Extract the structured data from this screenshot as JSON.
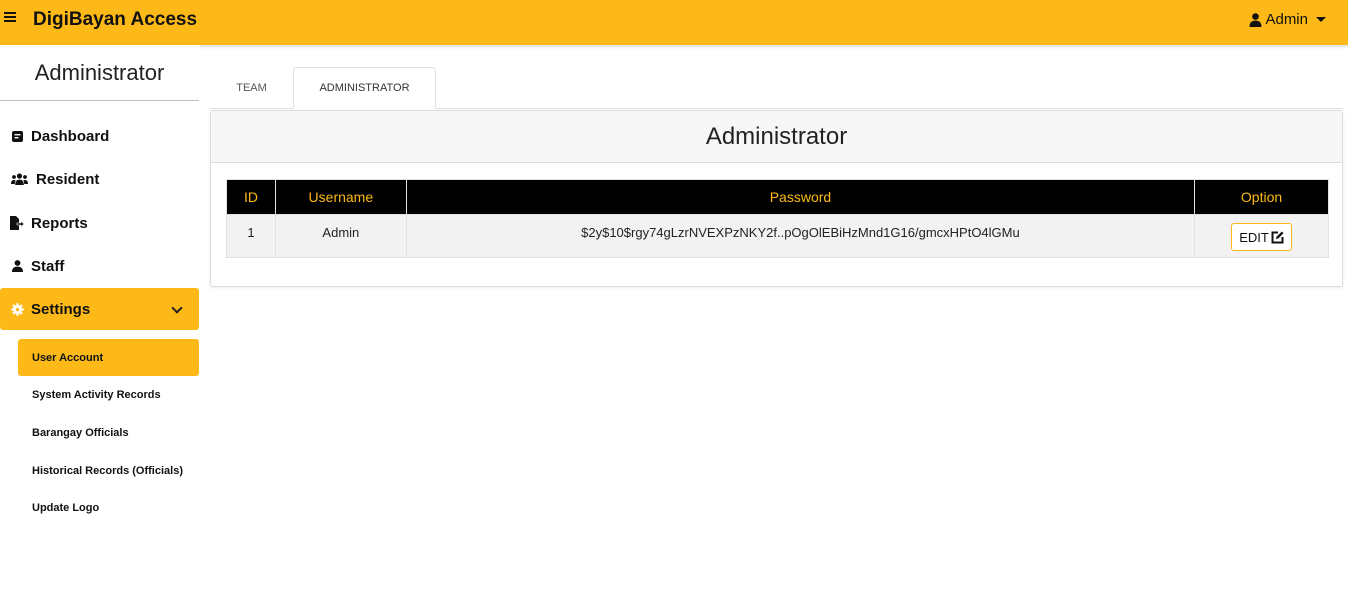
{
  "header": {
    "brand": "DigiBayan Access",
    "user_label": "Admin"
  },
  "sidebar": {
    "title": "Administrator",
    "items": [
      {
        "label": "Dashboard",
        "icon": "dashboard-icon"
      },
      {
        "label": "Resident",
        "icon": "users-icon"
      },
      {
        "label": "Reports",
        "icon": "file-export-icon"
      },
      {
        "label": "Staff",
        "icon": "user-icon"
      },
      {
        "label": "Settings",
        "icon": "gear-icon"
      }
    ],
    "sub_items": [
      {
        "label": "User Account"
      },
      {
        "label": "System Activity Records"
      },
      {
        "label": "Barangay Officials"
      },
      {
        "label": "Historical Records (Officials)"
      },
      {
        "label": "Update Logo"
      }
    ]
  },
  "tabs": [
    {
      "label": "TEAM"
    },
    {
      "label": "ADMINISTRATOR"
    }
  ],
  "card": {
    "title": "Administrator",
    "columns": [
      "ID",
      "Username",
      "Password",
      "Option"
    ],
    "rows": [
      {
        "id": "1",
        "username": "Admin",
        "password": "$2y$10$rgy74gLzrNVEXPzNKY2f..pOgOlEBiHzMnd1G16/gmcxHPtO4lGMu",
        "option_label": "EDIT"
      }
    ]
  },
  "colors": {
    "accent": "#fcb917",
    "table_header_bg": "#000000"
  }
}
